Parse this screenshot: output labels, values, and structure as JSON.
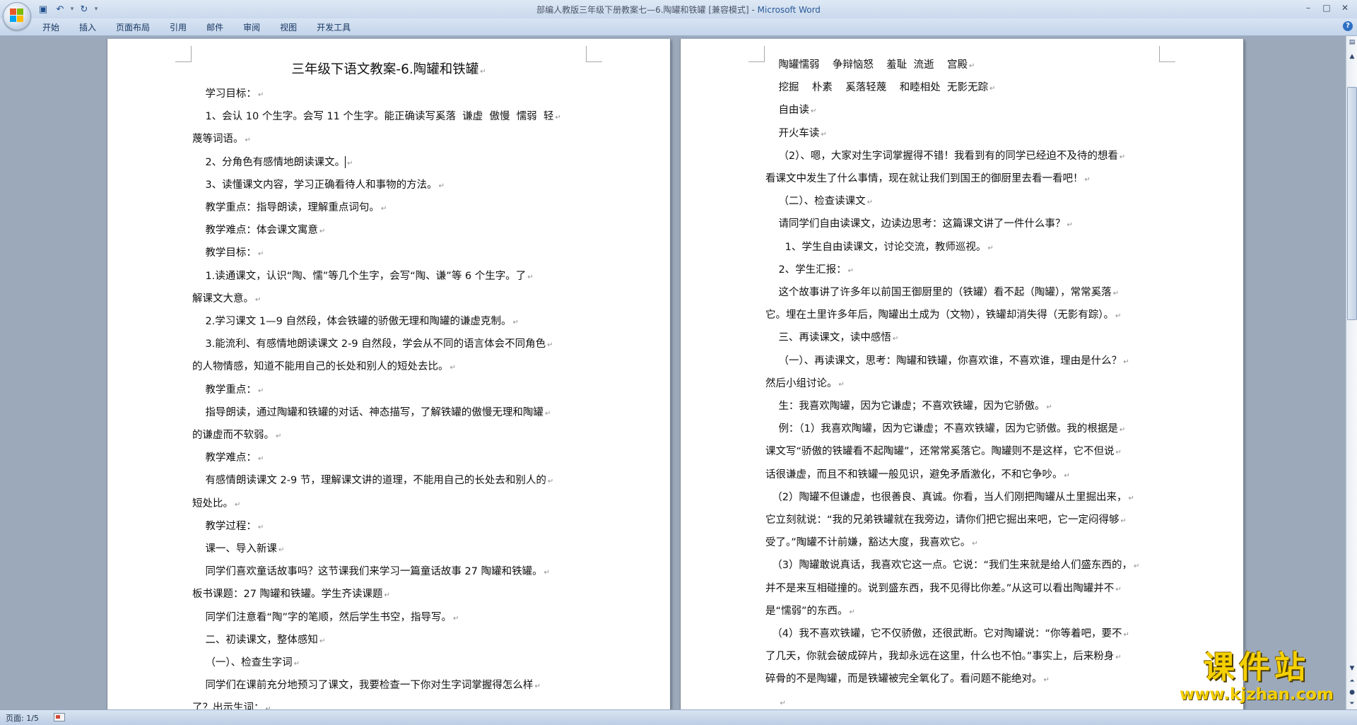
{
  "window": {
    "title_doc": "部编人教版三年级下册教案七—6.陶罐和铁罐 [兼容模式] - ",
    "title_app": "Microsoft Word",
    "controls": [
      "–",
      "□",
      "✕"
    ]
  },
  "qat": {
    "save_icon": "▣",
    "undo_icon": "↶",
    "redo_icon": "↻",
    "more_icon": "▾"
  },
  "tabs": [
    "开始",
    "插入",
    "页面布局",
    "引用",
    "邮件",
    "审阅",
    "视图",
    "开发工具"
  ],
  "help_icon": "?",
  "page1": {
    "title": "三年级下语文教案-6.陶罐和铁罐",
    "lines": [
      "    学习目标：",
      "    1、会认 10 个生字。会写 11 个生字。能正确读写奚落  谦虚  傲慢  懦弱  轻",
      "蔑等词语。",
      "    2、分角色有感情地朗读课文。",
      "    3、读懂课文内容，学习正确看待人和事物的方法。",
      "    教学重点：指导朗读，理解重点词句。",
      "    教学难点：体会课文寓意",
      "    教学目标：",
      "    1.读通课文，认识“陶、懦”等几个生字，会写“陶、谦”等 6 个生字。了",
      "解课文大意。",
      "    2.学习课文 1—9 自然段，体会铁罐的骄傲无理和陶罐的谦虚克制。",
      "    3.能流利、有感情地朗读课文 2-9 自然段，学会从不同的语言体会不同角色",
      "的人物情感，知道不能用自己的长处和别人的短处去比。",
      "    教学重点：",
      "    指导朗读，通过陶罐和铁罐的对话、神态描写，了解铁罐的傲慢无理和陶罐",
      "的谦虚而不软弱。",
      "    教学难点：",
      "    有感情朗读课文 2-9 节，理解课文讲的道理，不能用自己的长处去和别人的",
      "短处比。",
      "    教学过程：",
      "    课一、导入新课",
      "    同学们喜欢童话故事吗？这节课我们来学习一篇童话故事 27 陶罐和铁罐。",
      "板书课题：27 陶罐和铁罐。学生齐读课题",
      "    同学们注意看“陶”字的笔顺，然后学生书空，指导写。",
      "    二、初读课文，整体感知",
      "    （一）、检查生字词",
      "    同学们在课前充分地预习了课文，我要检查一下你对生字词掌握得怎么样",
      "了？出示生词："
    ]
  },
  "page2": {
    "lines": [
      "    陶罐懦弱    争辩恼怒    羞耻  流逝    宫殿",
      "    挖掘    朴素    奚落轻蔑    和睦相处  无影无踪",
      "    自由读",
      "    开火车读",
      "    （2）、嗯，大家对生字词掌握得不错！我看到有的同学已经迫不及待的想看",
      "看课文中发生了什么事情，现在就让我们到国王的御厨里去看一看吧！",
      "    （二）、检查读课文",
      "    请同学们自由读课文，边读边思考：这篇课文讲了一件什么事？",
      "      1、学生自由读课文，讨论交流，教师巡视。",
      "    2、学生汇报：",
      "    这个故事讲了许多年以前国王御厨里的（铁罐）看不起（陶罐），常常奚落",
      "它。埋在土里许多年后，陶罐出土成为（文物），铁罐却消失得（无影有踪）。",
      "    三、再读课文，读中感悟",
      "    （一）、再读课文，思考：陶罐和铁罐，你喜欢谁，不喜欢谁，理由是什么？",
      "然后小组讨论。",
      "    生：我喜欢陶罐，因为它谦虚；不喜欢铁罐，因为它骄傲。",
      "    例：（1）我喜欢陶罐，因为它谦虚；不喜欢铁罐，因为它骄傲。我的根据是",
      "课文写“骄傲的铁罐看不起陶罐”，还常常奚落它。陶罐则不是这样，它不但说",
      "话很谦虚，而且不和铁罐一般见识，避免矛盾激化，不和它争吵。",
      "  （2）陶罐不但谦虚，也很善良、真诚。你看，当人们刚把陶罐从土里掘出来，",
      "它立刻就说：“我的兄弟铁罐就在我旁边，请你们把它掘出来吧，它一定闷得够",
      "受了。”陶罐不计前嫌，豁达大度，我喜欢它。",
      "  （3）陶罐敢说真话，我喜欢它这一点。它说：“我们生来就是给人们盛东西的，",
      "并不是来互相碰撞的。说到盛东西，我不见得比你差。”从这可以看出陶罐并不",
      "是“懦弱”的东西。",
      "  （4）我不喜欢铁罐，它不仅骄傲，还很武断。它对陶罐说：“你等着吧，要不",
      "了几天，你就会破成碎片，我却永远在这里，什么也不怕。”事实上，后来粉身",
      "碎骨的不是陶罐，而是铁罐被完全氧化了。看问题不能绝对。",
      "    "
    ]
  },
  "statusbar": {
    "page_info": "页面: 1/5"
  },
  "watermark": {
    "cn": "课件站",
    "url": "www.kjzhan.com"
  }
}
